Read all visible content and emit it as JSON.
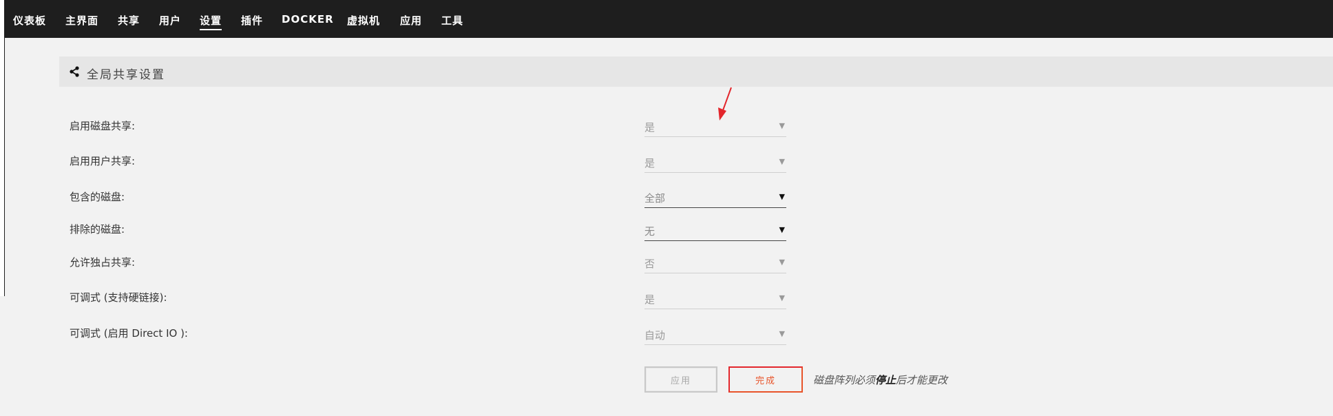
{
  "nav": {
    "items": [
      "仪表板",
      "主界面",
      "共享",
      "用户",
      "设置",
      "插件",
      "DOCKER",
      "虚拟机",
      "应用",
      "工具"
    ],
    "active": "设置"
  },
  "section": {
    "title": "全局共享设置",
    "icon": "share-icon"
  },
  "settings": [
    {
      "label": "启用磁盘共享:",
      "value": "是"
    },
    {
      "label": "启用用户共享:",
      "value": "是"
    },
    {
      "label": "包含的磁盘:",
      "value": "全部"
    },
    {
      "label": "排除的磁盘:",
      "value": "无"
    },
    {
      "label": "允许独占共享:",
      "value": "否"
    },
    {
      "label": "可调式 (支持硬链接):",
      "value": "是"
    },
    {
      "label": "可调式 (启用 Direct IO ):",
      "value": "自动"
    }
  ],
  "buttons": {
    "apply": "应用",
    "done": "完成"
  },
  "hint": {
    "before": "磁盘阵列必须",
    "strong": "停止",
    "after": "后才能更改"
  },
  "colors": {
    "navbar": "#1e1e1e",
    "background": "#f2f2f2",
    "accent_orange": "#e8542a",
    "annotation_red": "#e3262c"
  }
}
